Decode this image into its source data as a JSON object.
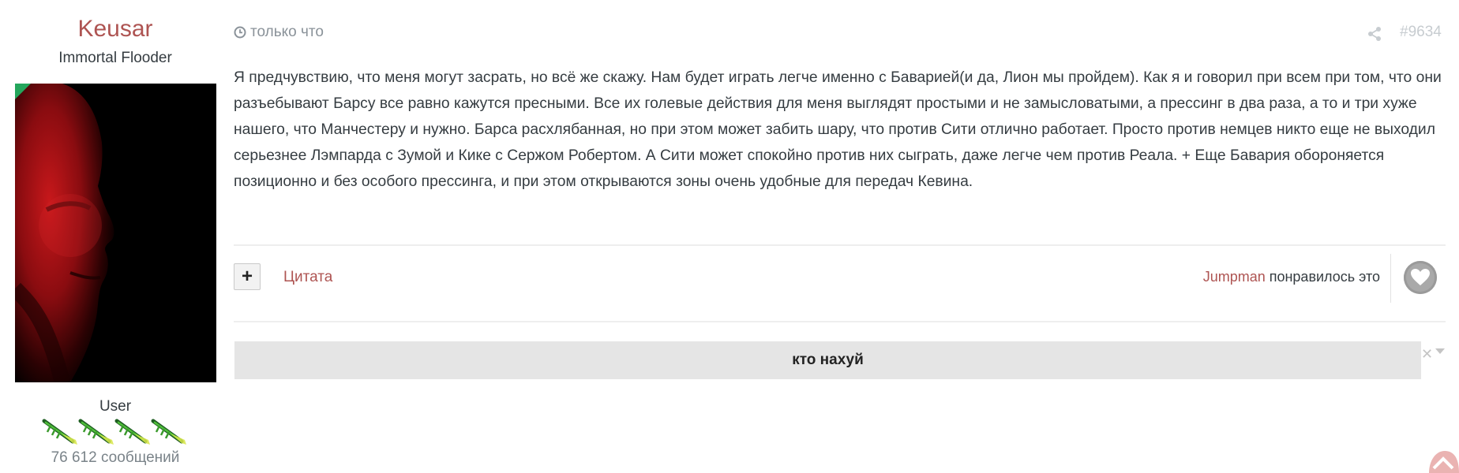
{
  "author": {
    "name": "Keusar",
    "title": "Immortal Flooder",
    "group": "User",
    "post_count": "76 612 сообщений",
    "rank_icons": 4
  },
  "post": {
    "time": "только что",
    "number": "#9634",
    "body": "Я предчувствию, что меня могут засрать, но всё же скажу. Нам будет играть легче именно с Баварией(и да, Лион мы пройдем). Как я и говорил при всем при том, что они разъебывают Барсу все равно кажутся пресными. Все их голевые действия для меня выглядят простыми и не замысловатыми, а прессинг в два раза, а то и три хуже нашего, что Манчестеру и нужно. Барса расхлябанная, но при этом может забить шару, что против Сити отлично работает. Просто против немцев никто еще не выходил серьезнее Лэмпарда с Зумой и Кике с Сержом Робертом. А Сити может спокойно против них сыграть, даже легче чем против Реала. + Еще Бавария обороняется позиционно и без особого прессинга, и при этом открываются зоны очень удобные для передач Кевина."
  },
  "actions": {
    "plus_label": "+",
    "quote_label": "Цитата"
  },
  "likes": {
    "user": "Jumpman",
    "text": " понравилось это"
  },
  "signature": {
    "text": "кто нахуй",
    "close_label": "✕"
  },
  "colors": {
    "accent": "#ae5452",
    "muted": "#8a9299",
    "signature_bg": "#e5e5e5"
  },
  "icons": [
    "clock-icon",
    "share-icon",
    "heart-icon",
    "close-icon",
    "chevron-down-icon",
    "scroll-top-icon",
    "rank-icon"
  ]
}
